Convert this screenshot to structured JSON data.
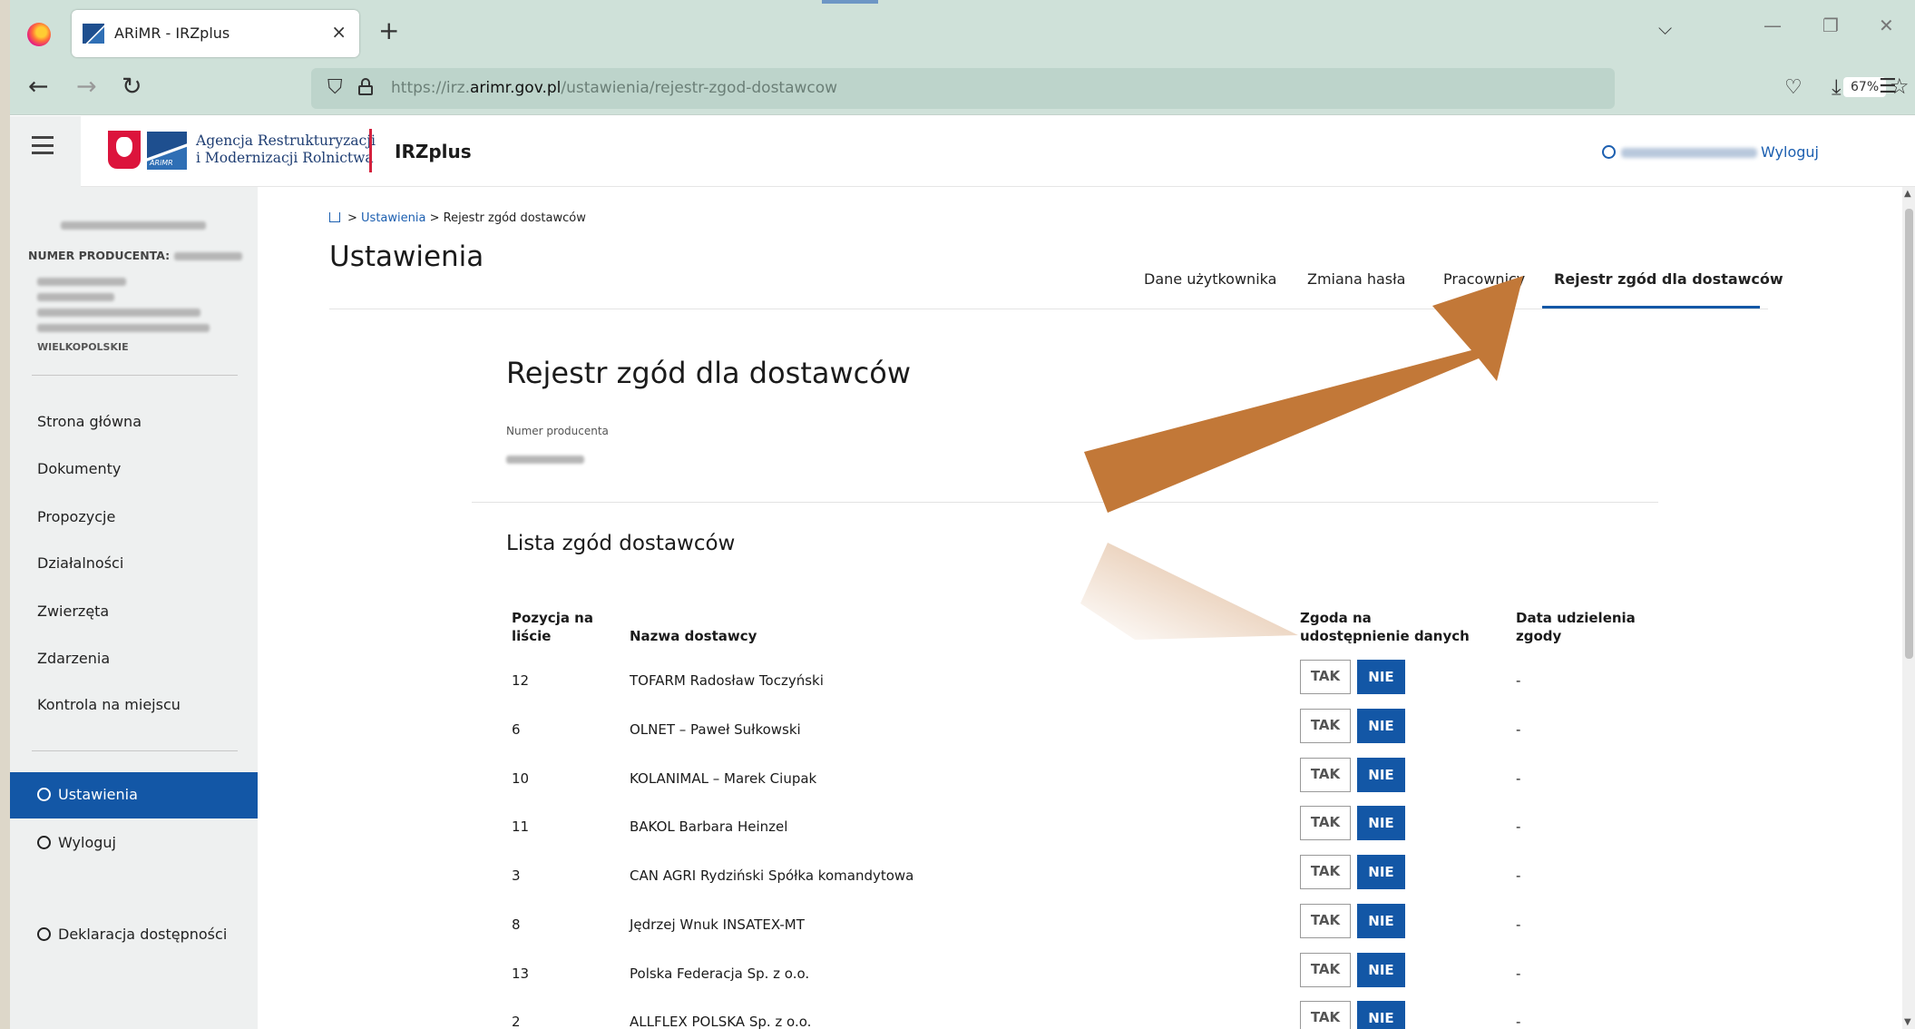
{
  "browser": {
    "tab_title": "ARiMR - IRZplus",
    "tab_close": "×",
    "new_tab": "+",
    "url_prefix": "https://irz.",
    "url_domain": "arimr.gov.pl",
    "url_path": "/ustawienia/rejestr-zgod-dostawcow",
    "zoom": "67%",
    "icons": [
      "firefox-icon",
      "back-icon",
      "forward-icon",
      "reload-icon",
      "shield-icon",
      "lock-icon",
      "star-icon",
      "pocket-icon",
      "download-icon",
      "menu-icon",
      "list-tabs-icon",
      "minimize-icon",
      "restore-icon",
      "close-window-icon"
    ]
  },
  "header": {
    "agency_line1": "Agencja Restrukturyzacji",
    "agency_line2": "i Modernizacji Rolnictwa",
    "logo_small_text": "ARiMR",
    "brand": "IRZplus",
    "logout": "Wyloguj"
  },
  "sidebar": {
    "producer_label": "NUMER PRODUCENTA:",
    "region": "WIELKOPOLSKIE",
    "nav": [
      "Strona główna",
      "Dokumenty",
      "Propozycje",
      "Działalności",
      "Zwierzęta",
      "Zdarzenia",
      "Kontrola na miejscu"
    ],
    "settings": "Ustawienia",
    "logout": "Wyloguj",
    "accessibility": "Deklaracja dostępności"
  },
  "breadcrumb": {
    "level1": "Ustawienia",
    "level2": "Rejestr zgód dostawców"
  },
  "page": {
    "title": "Ustawienia",
    "tabs": [
      "Dane użytkownika",
      "Zmiana hasła",
      "Pracownicy",
      "Rejestr zgód dla dostawców"
    ],
    "section_title": "Rejestr zgód dla dostawców",
    "producer_number_label": "Numer producenta",
    "list_title": "Lista zgód dostawców"
  },
  "table": {
    "headers": {
      "position": "Pozycja na liście",
      "supplier": "Nazwa dostawcy",
      "consent": "Zgoda na udostępnienie danych",
      "date": "Data udzielenia zgody"
    },
    "yes": "TAK",
    "no": "NIE",
    "rows": [
      {
        "pos": "12",
        "name": "TOFARM Radosław Toczyński",
        "date": "-"
      },
      {
        "pos": "6",
        "name": "OLNET – Paweł Sułkowski",
        "date": "-"
      },
      {
        "pos": "10",
        "name": "KOLANIMAL – Marek Ciupak",
        "date": "-"
      },
      {
        "pos": "11",
        "name": "BAKOL Barbara Heinzel",
        "date": "-"
      },
      {
        "pos": "3",
        "name": "CAN AGRI Rydziński Spółka komandytowa",
        "date": "-"
      },
      {
        "pos": "8",
        "name": "Jędrzej Wnuk INSATEX-MT",
        "date": "-"
      },
      {
        "pos": "13",
        "name": "Polska Federacja Sp. z o.o.",
        "date": "-"
      },
      {
        "pos": "2",
        "name": "ALLFLEX POLSKA Sp. z o.o.",
        "date": "-"
      }
    ]
  },
  "annotation": {
    "arrow_color": "#c27838"
  }
}
